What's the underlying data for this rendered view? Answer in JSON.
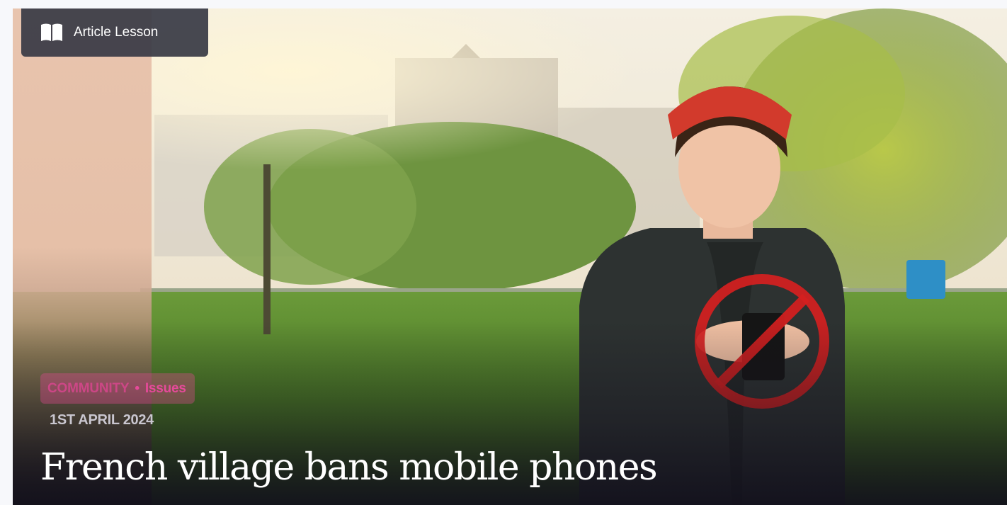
{
  "lesson_tag": {
    "label": "Article Lesson",
    "icon": "open-book-icon"
  },
  "article": {
    "category": "COMMUNITY",
    "subcategory": "Issues",
    "separator": "•",
    "date": "1ST APRIL 2024",
    "title": "French village bans mobile phones"
  },
  "hero_image": {
    "overlay_icon": "no-phone-prohibited-icon"
  },
  "colors": {
    "tag_background": "#373a44",
    "category_pill": "#ec4899",
    "prohibited_sign": "#d61f1f",
    "peach_strip": "#e8c4ae"
  }
}
